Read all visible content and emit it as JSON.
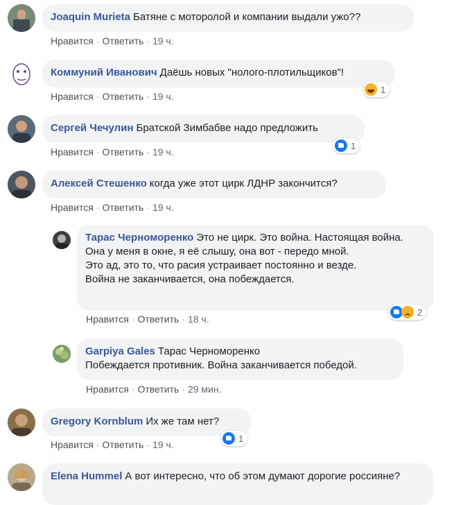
{
  "actions": {
    "like": "Нравится",
    "reply": "Ответить",
    "sep": "·"
  },
  "comments": [
    {
      "author": "Joaquin Murieta",
      "text": "Батяне с моторолой и компании выдали ужо??",
      "time": "19 ч."
    },
    {
      "author": "Коммуний Иванович",
      "text": "Даёшь новых \"нолого-плотильщиков\"!",
      "time": "19 ч.",
      "reaction_count": "1",
      "reaction_icons": [
        "haha"
      ]
    },
    {
      "author": "Сергей Чечулин",
      "text": "Братской Зимбабве надо предложить",
      "time": "19 ч.",
      "reaction_count": "1",
      "reaction_icons": [
        "like"
      ]
    },
    {
      "author": "Алексей Стешенко",
      "text": "когда уже этот цирк ЛДНР закончится?",
      "time": "19 ч."
    },
    {
      "author": "Тарас Черноморенко",
      "text": "Это не цирк. Это война. Настоящая война.\nОна у меня в окне, я её слышу, она вот - передо мной.\nЭто ад, это то, что расия устраивает постоянно и везде.\nВойна не заканчивается, она побеждается.",
      "time": "18 ч.",
      "reaction_count": "2",
      "reaction_icons": [
        "like",
        "sad"
      ]
    },
    {
      "author": "Garpiya Gales",
      "text": "Тарас Черноморенко\nПобеждается противник. Война заканчивается победой.",
      "time": "29 мин."
    },
    {
      "author": "Gregory Kornblum",
      "text": "Их же там нет?",
      "time": "19 ч.",
      "reaction_count": "1",
      "reaction_icons": [
        "like"
      ]
    },
    {
      "author": "Elena Hummel",
      "text": "А вот интересно, что об этом думают дорогие россияне?",
      "time": ""
    }
  ],
  "colors": {
    "author": "#385898",
    "bubble": "#f2f3f5",
    "meta": "#606770",
    "like": "#1877f2",
    "emoji": "#f7b125"
  }
}
